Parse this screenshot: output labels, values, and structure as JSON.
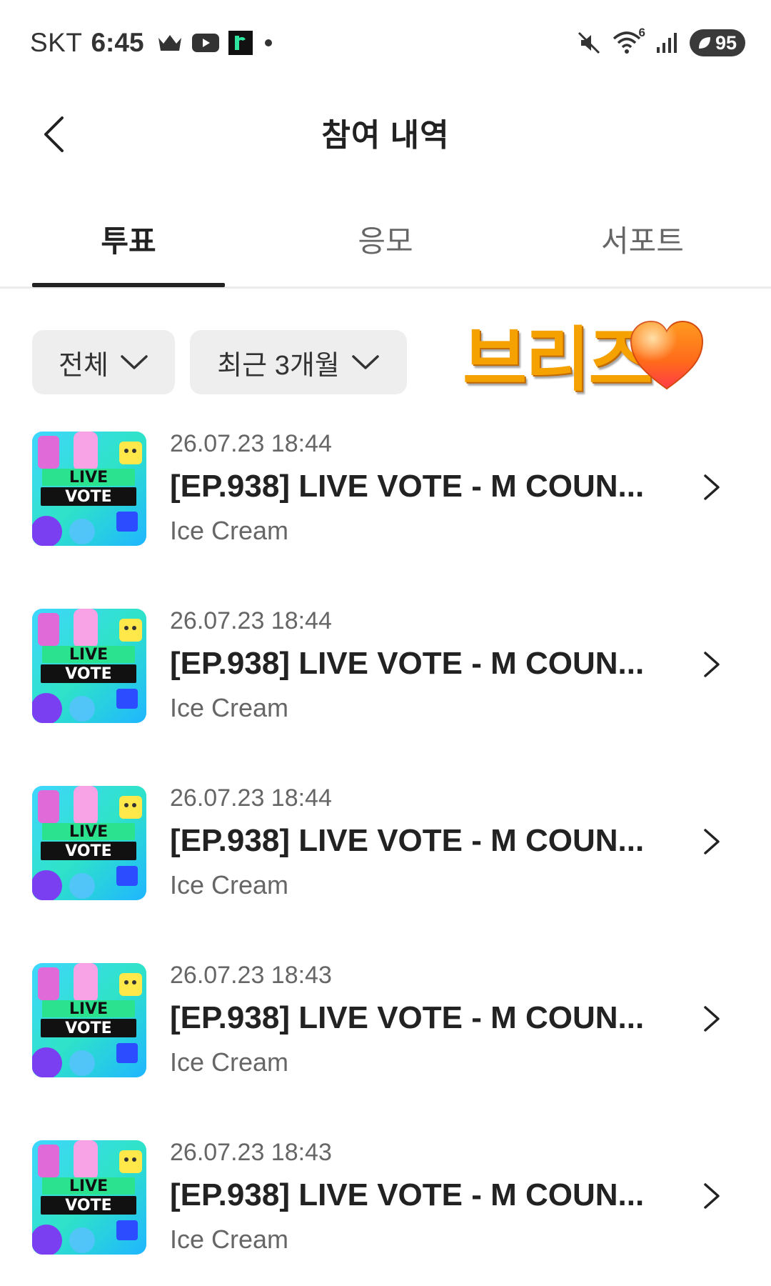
{
  "status_bar": {
    "carrier": "SKT",
    "time": "6:45",
    "wifi_superscript": "6",
    "battery": "95"
  },
  "header": {
    "title": "참여 내역"
  },
  "tabs": [
    {
      "label": "투표",
      "active": true
    },
    {
      "label": "응모",
      "active": false
    },
    {
      "label": "서포트",
      "active": false
    }
  ],
  "filters": {
    "category": "전체",
    "period": "최근 3개월"
  },
  "overlay": {
    "text": "브리즈",
    "emoji": "orange-heart-icon"
  },
  "thumbnail_text": {
    "line1": "LIVE",
    "line2": "VOTE"
  },
  "items": [
    {
      "date": "26.07.23 18:44",
      "title": "[EP.938] LIVE VOTE - M COUN...",
      "subtitle": "Ice Cream"
    },
    {
      "date": "26.07.23 18:44",
      "title": "[EP.938] LIVE VOTE - M COUN...",
      "subtitle": "Ice Cream"
    },
    {
      "date": "26.07.23 18:44",
      "title": "[EP.938] LIVE VOTE - M COUN...",
      "subtitle": "Ice Cream"
    },
    {
      "date": "26.07.23 18:43",
      "title": "[EP.938] LIVE VOTE - M COUN...",
      "subtitle": "Ice Cream"
    },
    {
      "date": "26.07.23 18:43",
      "title": "[EP.938] LIVE VOTE - M COUN...",
      "subtitle": "Ice Cream"
    }
  ],
  "colors": {
    "accent_text": "#222222",
    "muted_text": "#666666",
    "chip_bg": "#eeeeee",
    "overlay_orange": "#f5a200"
  }
}
